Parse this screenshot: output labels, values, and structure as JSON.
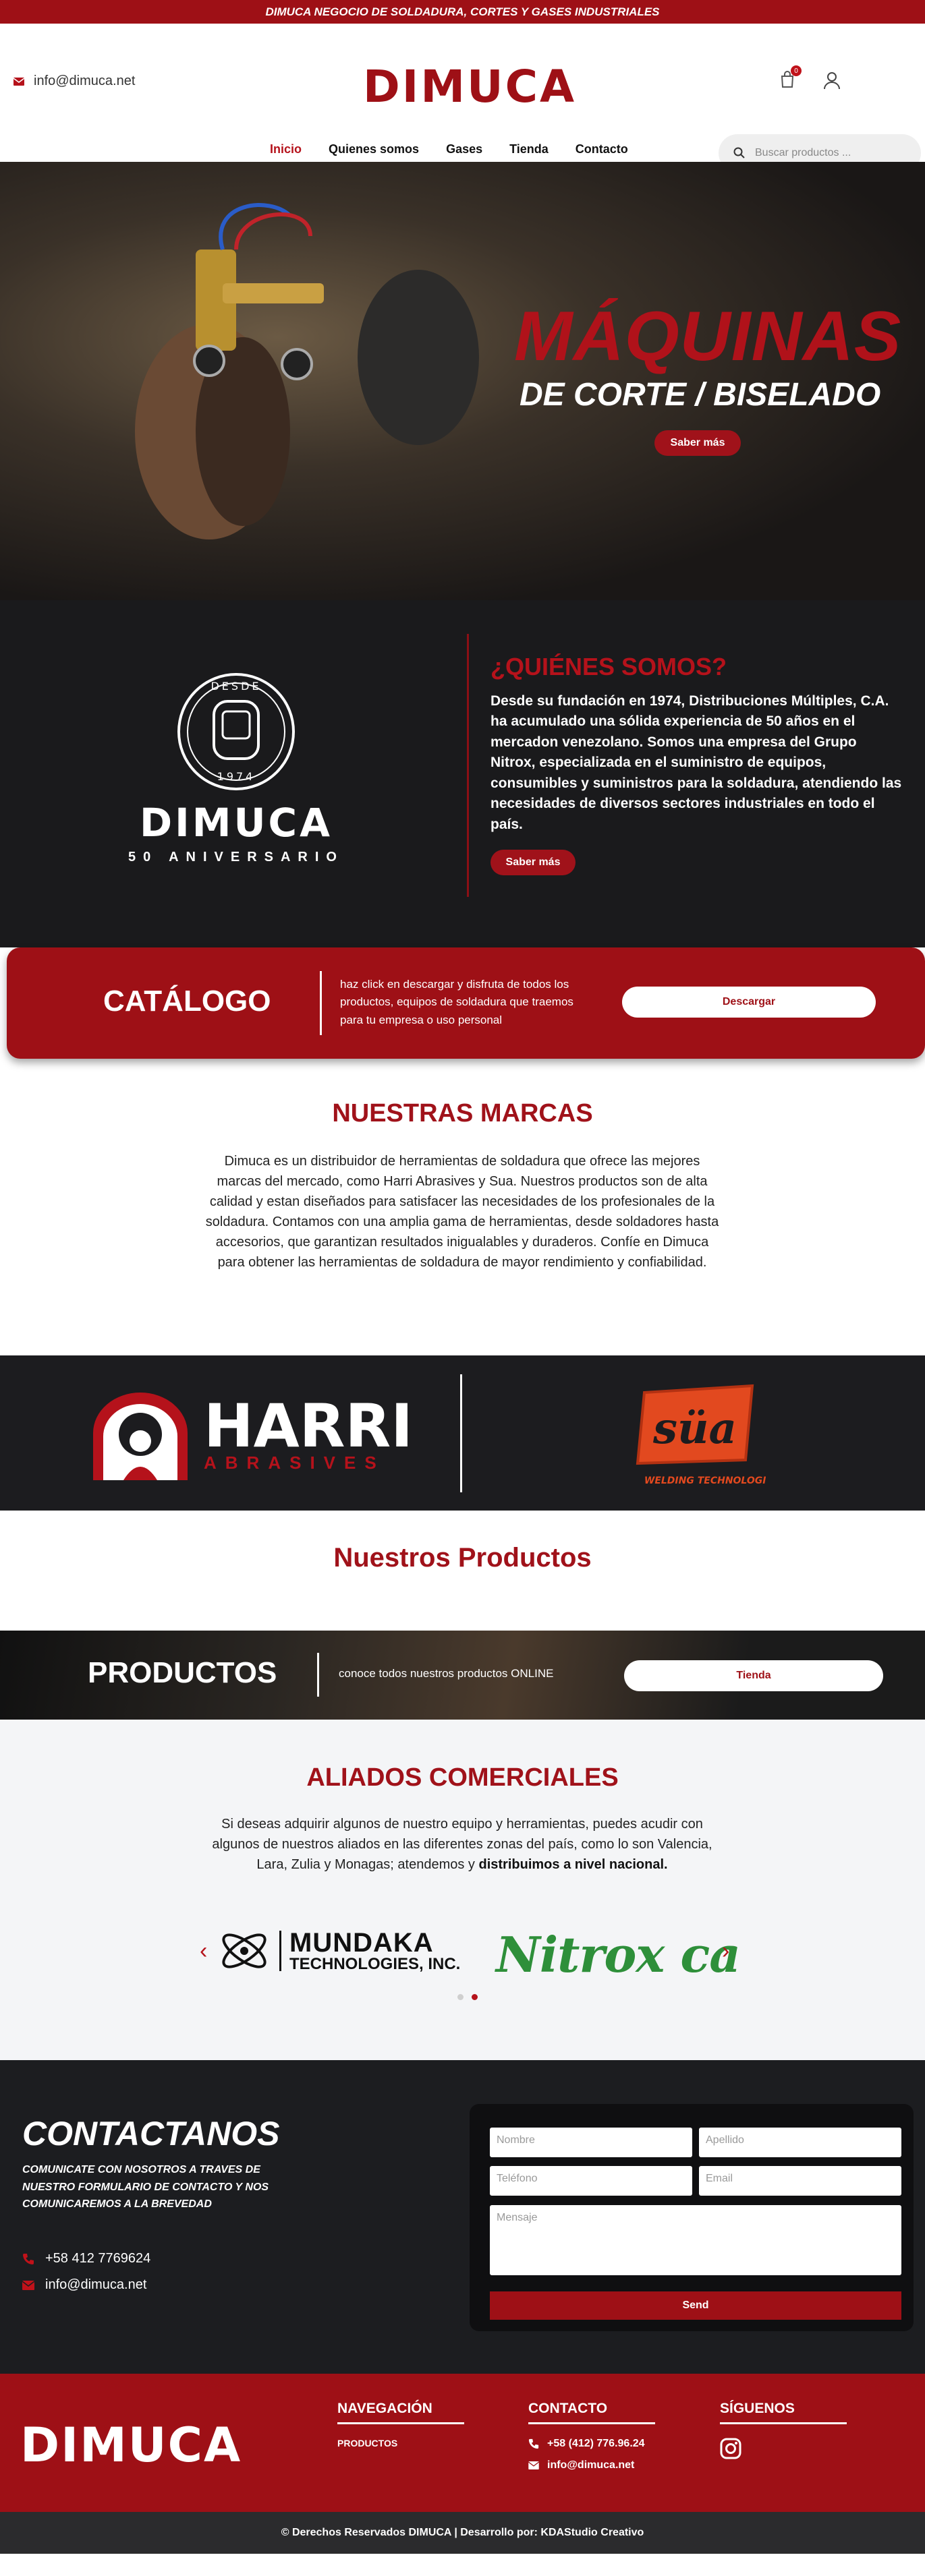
{
  "topbar": {
    "text": "DIMUCA NEGOCIO DE SOLDADURA, CORTES Y GASES INDUSTRIALES"
  },
  "header": {
    "email": "info@dimuca.net",
    "logo": "DIMUCA",
    "cart_count": "0",
    "nav": [
      "Inicio",
      "Quienes somos",
      "Gases",
      "Tienda",
      "Contacto"
    ],
    "search_placeholder": "Buscar productos ..."
  },
  "hero": {
    "title": "MÁQUINAS",
    "subtitle": "DE CORTE / BISELADO",
    "button": "Saber más"
  },
  "about": {
    "seal_top": "DESDE",
    "seal_year": "1974",
    "brand": "DIMUCA",
    "anniversary": "50 ANIVERSARIO",
    "title": "¿QUIÉNES SOMOS?",
    "text": "Desde su fundación en 1974, Distribuciones Múltiples, C.A. ha acumulado una sólida experiencia de 50 años en el mercadon venezolano. Somos una empresa del Grupo Nitrox, especializada en el suministro de equipos, consumibles y suministros para la soldadura, atendiendo las necesidades de diversos sectores industriales en todo el país.",
    "button": "Saber más"
  },
  "catalog": {
    "title": "CATÁLOGO",
    "text": "haz click en descargar y disfruta de todos los productos, equipos de soldadura que traemos para tu empresa o uso personal",
    "button": "Descargar"
  },
  "brands": {
    "title": "NUESTRAS MARCAS",
    "text": "Dimuca es un distribuidor de herramientas de soldadura que ofrece las mejores marcas del mercado, como Harri Abrasives y Sua. Nuestros productos son de alta calidad y estan diseñados para satisfacer las necesidades de los profesionales de la soldadura. Contamos con una amplia gama de herramientas, desde soldadores hasta accesorios, que garantizan resultados inigualables y duraderos. Confíe en Dimuca para obtener las herramientas de soldadura de mayor rendimiento y confiabilidad."
  },
  "brand_logos": {
    "harri": "HARRI",
    "harri_sub": "ABRASIVES",
    "sua": "süa",
    "sua_sub": "WELDING TECHNOLOGIES"
  },
  "products": {
    "heading": "Nuestros Productos",
    "title": "PRODUCTOS",
    "text": "conoce todos nuestros productos ONLINE",
    "button": "Tienda"
  },
  "allies": {
    "title": "ALIADOS COMERCIALES",
    "text": "Si deseas adquirir algunos de nuestro equipo y herramientas, puedes acudir con algunos de nuestros aliados en las diferentes zonas del país, como lo son Valencia, Lara, Zulia y Monagas; atendemos y",
    "text_bold": "distribuimos a nivel nacional.",
    "mundaka": "MUNDAKA",
    "mundaka_sub": "TECHNOLOGIES, INC.",
    "nitrox": "Nitrox ca"
  },
  "contact": {
    "title": "CONTACTANOS",
    "subtitle": "COMUNICATE CON NOSOTROS A TRAVES DE NUESTRO FORMULARIO DE CONTACTO Y NOS COMUNICAREMOS A LA BREVEDAD",
    "phone": "+58 412 7769624",
    "email": "info@dimuca.net",
    "form": {
      "nombre": "Nombre",
      "apellido": "Apellido",
      "telefono": "Teléfono",
      "email": "Email",
      "mensaje": "Mensaje",
      "send": "Send"
    }
  },
  "footer": {
    "logo": "DIMUCA",
    "nav_title": "NAVEGACIÓN",
    "nav_item": "PRODUCTOS",
    "contact_title": "CONTACTO",
    "phone": "+58 (412) 776.96.24",
    "email": "info@dimuca.net",
    "social_title": "SÍGUENOS",
    "copyright": "© Derechos Reservados DIMUCA | Desarrollo por: KDAStudio Creativo"
  },
  "colors": {
    "brand_red": "#9e1016",
    "dark": "#1a1a1c",
    "light_bg": "#f4f5f7"
  }
}
